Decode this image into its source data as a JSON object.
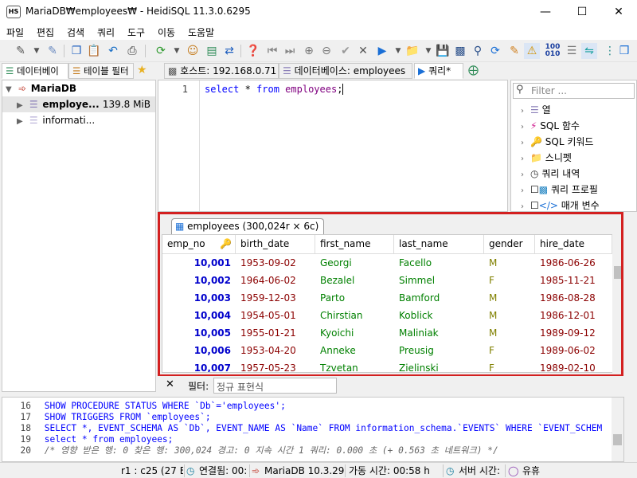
{
  "window": {
    "title": "MariaDB₩employees₩ - HeidiSQL 11.3.0.6295",
    "icon_text": "HS"
  },
  "menu": [
    "파일",
    "편집",
    "검색",
    "쿼리",
    "도구",
    "이동",
    "도움말"
  ],
  "left_tabs": {
    "tab1": "데이터베이",
    "tab2": "테이블 필터"
  },
  "tree": {
    "root": "MariaDB",
    "items": [
      {
        "label": "employe...",
        "size": "139.8 MiB"
      },
      {
        "label": "informati..."
      }
    ]
  },
  "main_tabs": {
    "host": "호스트: 192.168.0.71",
    "database": "데이터베이스: employees",
    "query": "쿼리*"
  },
  "editor": {
    "line_number": "1",
    "code": {
      "kw1": "select",
      "star": " * ",
      "kw2": "from",
      "table": " employees",
      "semi": ";"
    }
  },
  "helpers": {
    "filter_placeholder": "Filter ...",
    "items": [
      "열",
      "SQL 함수",
      "SQL 키워드",
      "스니펫",
      "쿼리 내역",
      "쿼리 프로필",
      "매개 변수"
    ]
  },
  "result": {
    "tab_label": "employees (300,024r × 6c)",
    "columns": [
      "emp_no",
      "birth_date",
      "first_name",
      "last_name",
      "gender",
      "hire_date"
    ],
    "rows": [
      [
        "10,001",
        "1953-09-02",
        "Georgi",
        "Facello",
        "M",
        "1986-06-26"
      ],
      [
        "10,002",
        "1964-06-02",
        "Bezalel",
        "Simmel",
        "F",
        "1985-11-21"
      ],
      [
        "10,003",
        "1959-12-03",
        "Parto",
        "Bamford",
        "M",
        "1986-08-28"
      ],
      [
        "10,004",
        "1954-05-01",
        "Chirstian",
        "Koblick",
        "M",
        "1986-12-01"
      ],
      [
        "10,005",
        "1955-01-21",
        "Kyoichi",
        "Maliniak",
        "M",
        "1989-09-12"
      ],
      [
        "10,006",
        "1953-04-20",
        "Anneke",
        "Preusig",
        "F",
        "1989-06-02"
      ],
      [
        "10,007",
        "1957-05-23",
        "Tzvetan",
        "Zielinski",
        "F",
        "1989-02-10"
      ]
    ]
  },
  "filter": {
    "label": "필터:",
    "placeholder": "정규 표현식"
  },
  "log": {
    "lines": [
      {
        "num": "16",
        "text": "SHOW PROCEDURE STATUS WHERE `Db`='employees';"
      },
      {
        "num": "17",
        "text": "SHOW TRIGGERS FROM `employees`;"
      },
      {
        "num": "18",
        "text": "SELECT *, EVENT_SCHEMA AS `Db`, EVENT_NAME AS `Name` FROM information_schema.`EVENTS` WHERE `EVENT_SCHEM"
      },
      {
        "num": "19",
        "text": "select * from employees;"
      },
      {
        "num": "20",
        "text": "/* 영향 받은 행: 0  찾은 행: 300,024  경고: 0  지속 시간 1 쿼리: 0.000 초 (+ 0.563 초 네트워크) */"
      }
    ]
  },
  "status": {
    "pos": "r1 : c25 (27 B)",
    "connected": "연결됨: 00:",
    "server": "MariaDB 10.3.29",
    "uptime": "가동 시간: 00:58 h",
    "server_time": "서버 시간:",
    "idle": "유휴"
  },
  "colors": {
    "number_blue": "#0000cc",
    "date_red": "#8b0000",
    "text_green": "#008000",
    "enum_olive": "#808000",
    "keyword_blue": "#0000ff",
    "table_purple": "#800080",
    "highlight_red": "#d32020"
  }
}
